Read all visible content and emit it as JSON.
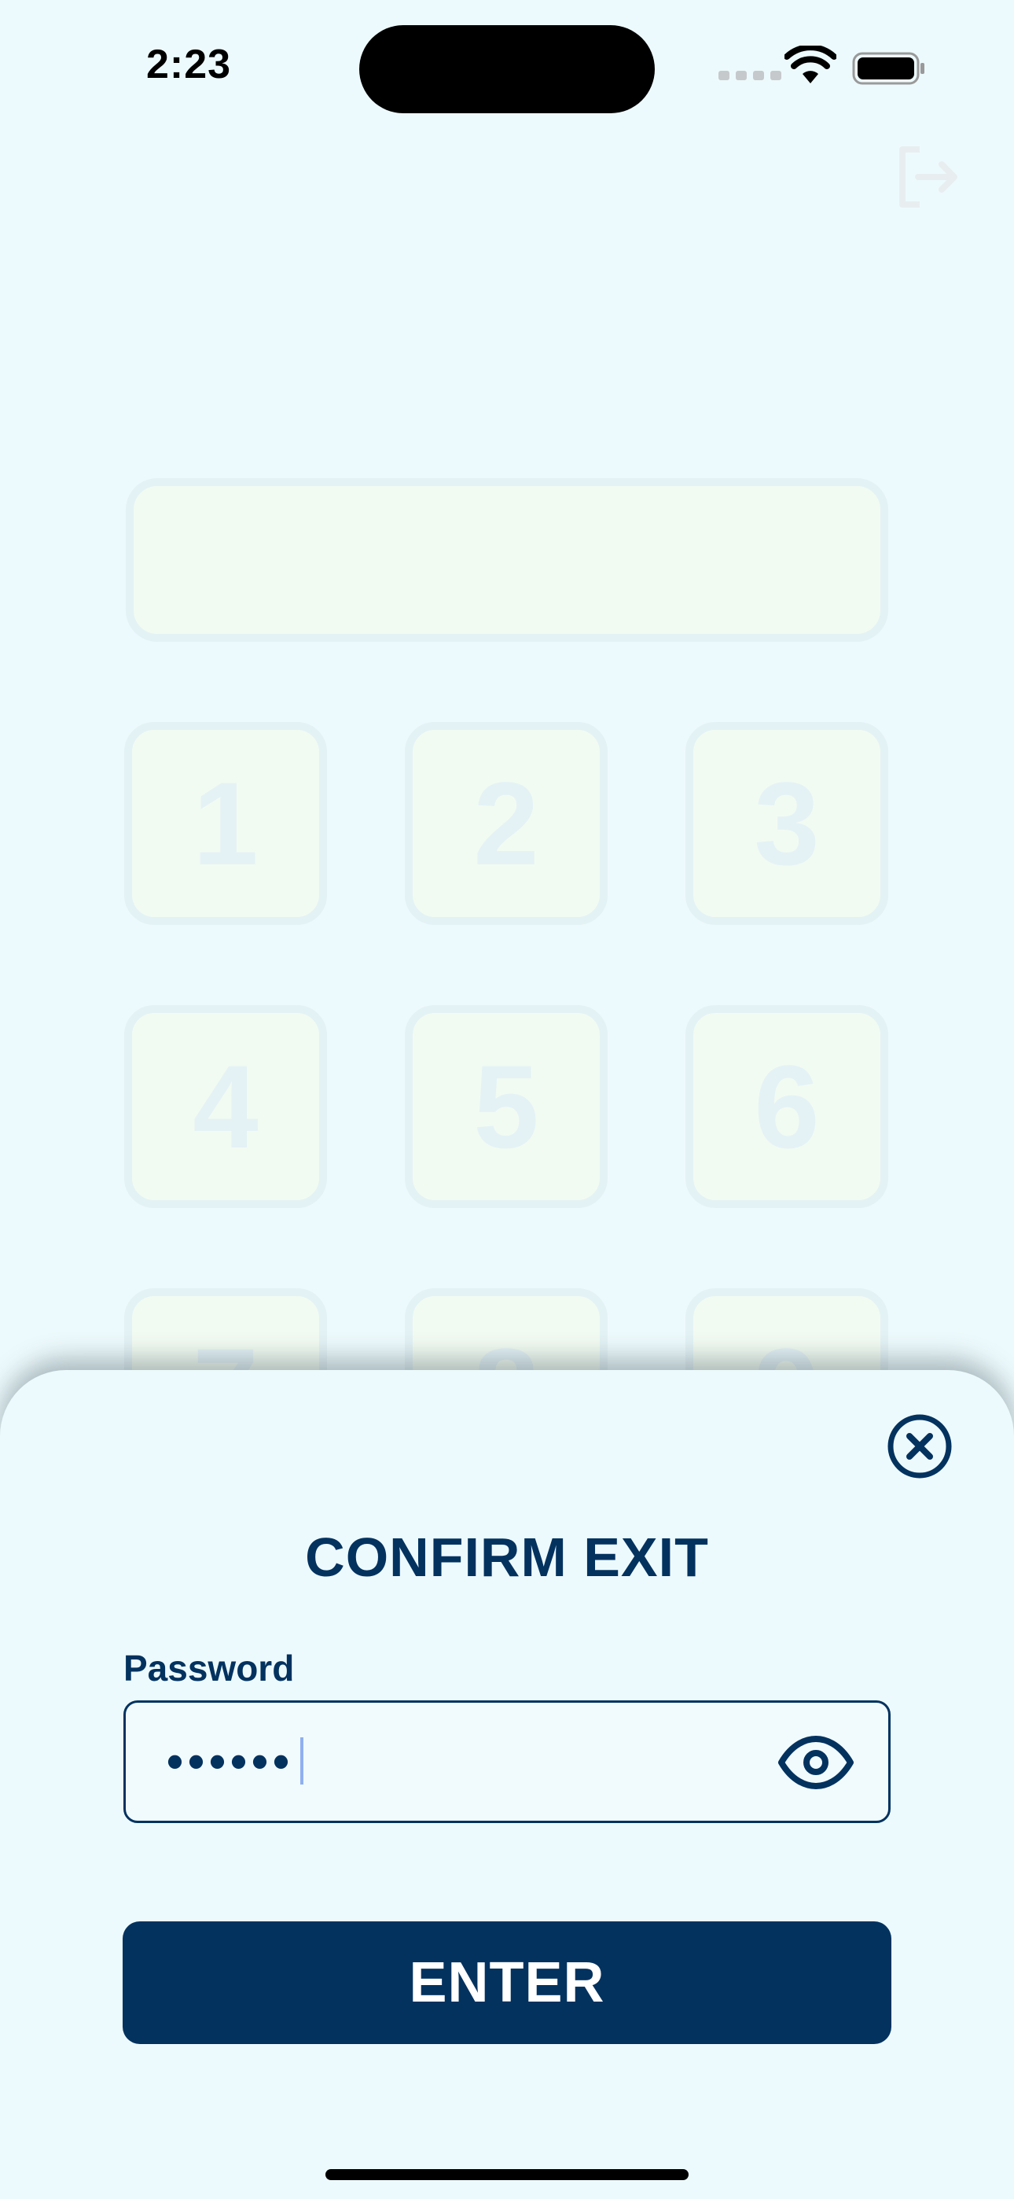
{
  "status_bar": {
    "time": "2:23",
    "icons": [
      "cellular-signal-icon",
      "wifi-icon",
      "battery-icon"
    ]
  },
  "header": {
    "exit_icon": "logout-icon"
  },
  "keypad": {
    "keys": [
      "1",
      "2",
      "3",
      "4",
      "5",
      "6",
      "7",
      "8",
      "9"
    ]
  },
  "sheet": {
    "close_icon": "close-circle-icon",
    "title": "CONFIRM EXIT",
    "password_label": "Password",
    "password_value": "••••••",
    "eye_icon": "eye-icon",
    "enter_label": "ENTER"
  },
  "colors": {
    "background": "#edfafd",
    "primary": "#03325f",
    "faded_key_bg": "#f2fbf2",
    "faded_key_border": "#e3f2f5"
  }
}
